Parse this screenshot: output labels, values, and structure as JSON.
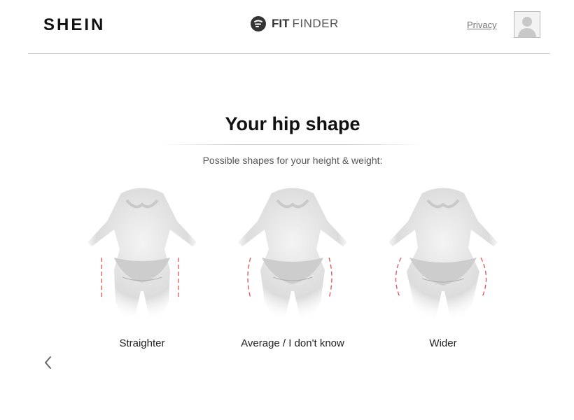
{
  "header": {
    "brand": "SHEIN",
    "fit_finder_bold": "FIT",
    "fit_finder_light": "FINDER",
    "privacy_label": "Privacy"
  },
  "main": {
    "title": "Your hip shape",
    "subtitle": "Possible shapes for your height & weight:",
    "options": [
      {
        "label": "Straighter"
      },
      {
        "label": "Average / I don't know"
      },
      {
        "label": "Wider"
      }
    ]
  },
  "colors": {
    "hip_guide": "#e05050",
    "divider": "#cfcfcf"
  }
}
